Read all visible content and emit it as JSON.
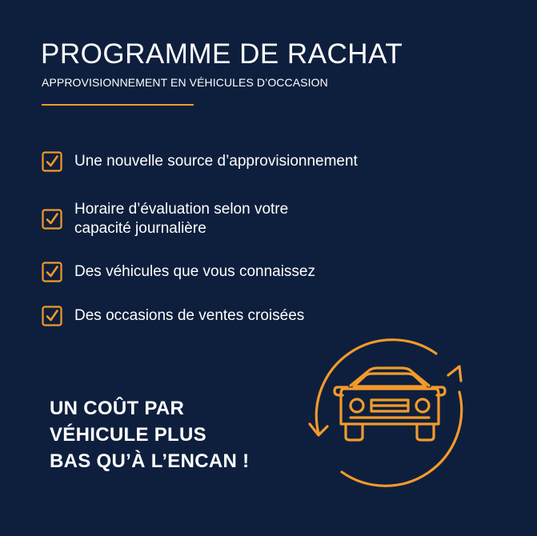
{
  "header": {
    "title": "PROGRAMME DE RACHAT",
    "subtitle": "APPROVISIONNEMENT EN VÉHICULES D’OCCASION"
  },
  "benefits": [
    {
      "text": "Une nouvelle source d’approvisionnement"
    },
    {
      "line1": "Horaire d’évaluation selon votre",
      "line2": "capacité journalière"
    },
    {
      "text": "Des véhicules que vous connaissez"
    },
    {
      "text": "Des occasions de ventes croisées"
    }
  ],
  "cta": {
    "line1": "UN COÛT PAR",
    "line2": "VÉHICULE PLUS",
    "line3": "BAS QU’À L’ENCAN !"
  },
  "colors": {
    "background": "#0e1f3d",
    "accent": "#f39a2b",
    "text": "#ffffff"
  },
  "icons": {
    "check": "check-icon",
    "graphic": "car-refresh-icon"
  }
}
